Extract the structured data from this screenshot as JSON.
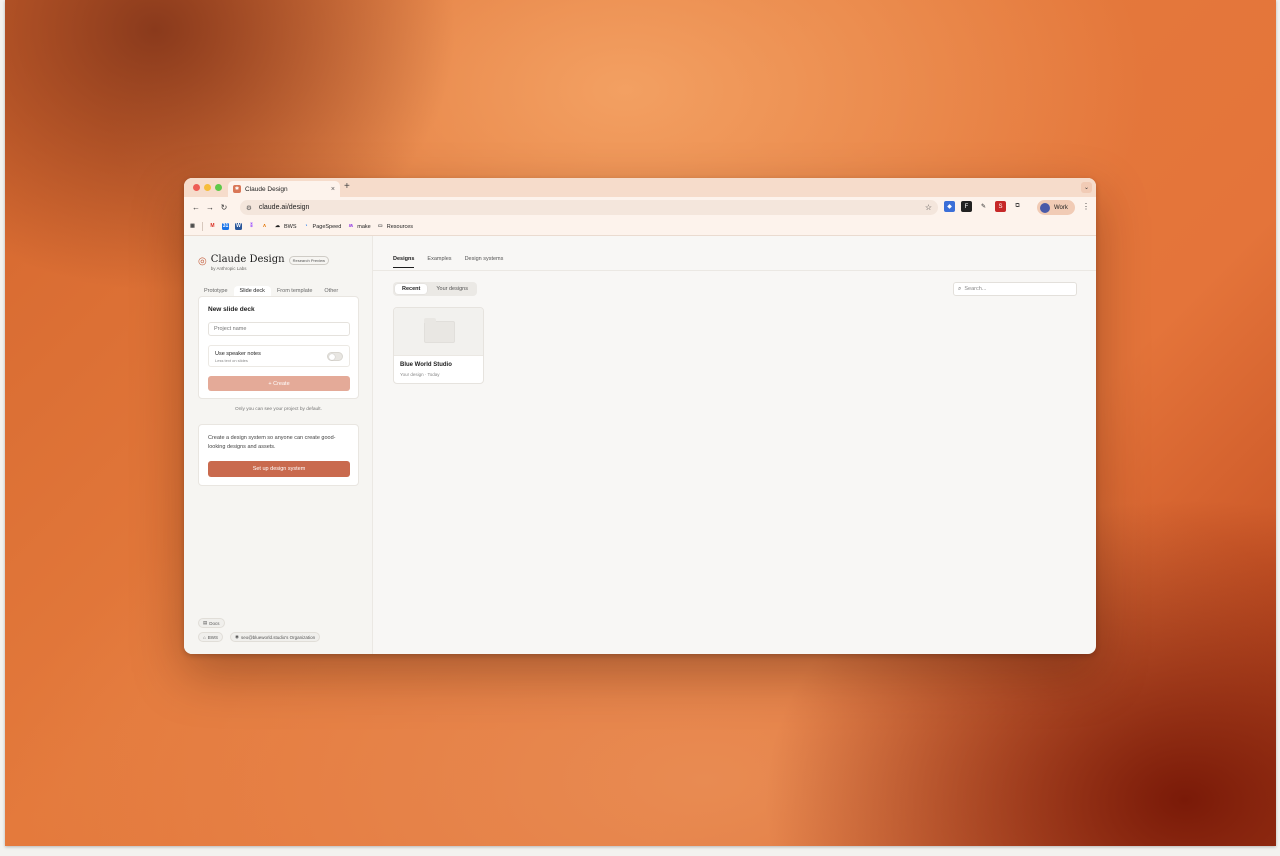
{
  "browser": {
    "tab_title": "Claude Design",
    "tab_close": "×",
    "new_tab": "+",
    "url": "claude.ai/design",
    "profile_label": "Work",
    "bookmarks": [
      {
        "label": "",
        "icon": "gmail-icon"
      },
      {
        "label": "",
        "icon": "calendar-icon"
      },
      {
        "label": "",
        "icon": "docs-icon"
      },
      {
        "label": "",
        "icon": "figma-icon"
      },
      {
        "label": "",
        "icon": "analytics-icon"
      },
      {
        "label": "BWS",
        "icon": "bws-icon"
      },
      {
        "label": "PageSpeed",
        "icon": "pagespeed-icon"
      },
      {
        "label": "make",
        "icon": "make-icon"
      },
      {
        "label": "Resources",
        "icon": "folder-icon"
      }
    ]
  },
  "sidebar": {
    "brand": "Claude Design",
    "byline": "by Anthropic Labs",
    "badge": "Research Preview",
    "mode_tabs": [
      "Prototype",
      "Slide deck",
      "From template",
      "Other"
    ],
    "active_mode": "Slide deck",
    "form": {
      "title": "New slide deck",
      "project_placeholder": "Project name",
      "notes_label": "Use speaker notes",
      "notes_sub": "Less text on slides",
      "create_label": "+ Create"
    },
    "privacy_note": "Only you can see your project by default.",
    "design_system": {
      "text": "Create a design system so anyone can create good-looking designs and assets.",
      "button": "Set up design system"
    },
    "footer": {
      "docs": "Docs",
      "org_short": "BWS",
      "org_full": "seo@blueworld.studio's Organization"
    }
  },
  "main": {
    "tabs": [
      "Designs",
      "Examples",
      "Design systems"
    ],
    "filters": [
      "Recent",
      "Your designs"
    ],
    "search_placeholder": "Search...",
    "designs": [
      {
        "title": "Blue World Studio",
        "meta": "Your design · Today"
      }
    ]
  },
  "colors": {
    "accent": "#c96a4e",
    "accent_disabled": "#e4aa98"
  }
}
